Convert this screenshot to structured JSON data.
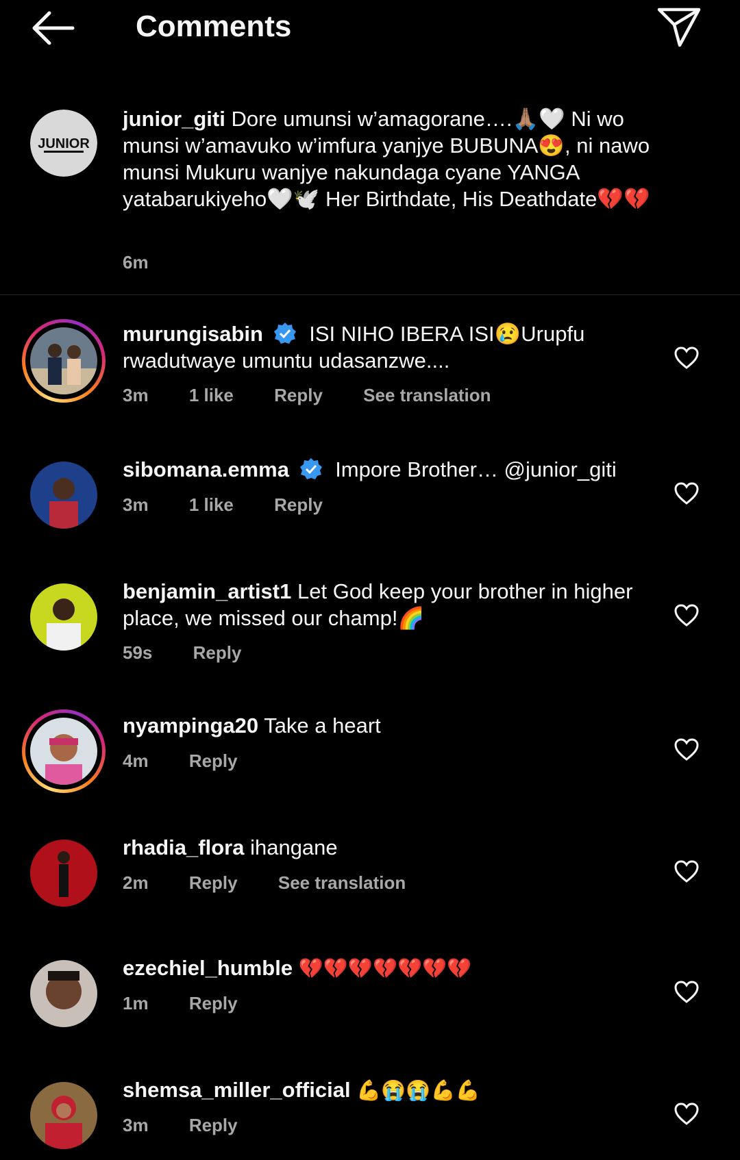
{
  "header": {
    "title": "Comments"
  },
  "caption": {
    "username": "junior_giti",
    "avatar_text": "JUNIOR",
    "text": "Dore umunsi w’amagorane….🙏🏽🤍 Ni wo munsi w’amavuko w’imfura yanjye BUBUNA😍, ni nawo munsi Mukuru wanjye nakundaga cyane YANGA yatabarukiyeho🤍🕊️ Her Birthdate, His Deathdate💔💔",
    "time": "6m"
  },
  "comments": [
    {
      "username": "murungisabin",
      "verified": true,
      "text": "ISI NIHO IBERA ISI😢Urupfu rwadutwaye umuntu udasanzwe....",
      "time": "3m",
      "likes": "1 like",
      "reply": "Reply",
      "translation": "See translation"
    },
    {
      "username": "sibomana.emma",
      "verified": true,
      "text": "Impore Brother… @junior_giti",
      "time": "3m",
      "likes": "1 like",
      "reply": "Reply"
    },
    {
      "username": "benjamin_artist1",
      "verified": false,
      "text": "Let God keep your brother in higher place, we missed our champ!🌈",
      "time": "59s",
      "reply": "Reply"
    },
    {
      "username": "nyampinga20",
      "verified": false,
      "text": "Take a heart",
      "time": "4m",
      "reply": "Reply"
    },
    {
      "username": "rhadia_flora",
      "verified": false,
      "text": "ihangane",
      "time": "2m",
      "reply": "Reply",
      "translation": "See translation"
    },
    {
      "username": "ezechiel_humble",
      "verified": false,
      "text": "💔💔💔💔💔💔💔",
      "time": "1m",
      "reply": "Reply"
    },
    {
      "username": "shemsa_miller_official",
      "verified": false,
      "text": "💪😭😭💪💪",
      "time": "3m",
      "reply": "Reply"
    }
  ],
  "icons": {
    "back": "arrow-left-icon",
    "send": "paper-plane-icon",
    "heart": "heart-outline-icon",
    "verified": "verified-badge-icon"
  },
  "colors": {
    "background": "#000000",
    "text": "#f5f5f5",
    "secondary": "#a8a8a8",
    "verified": "#3897f0"
  }
}
